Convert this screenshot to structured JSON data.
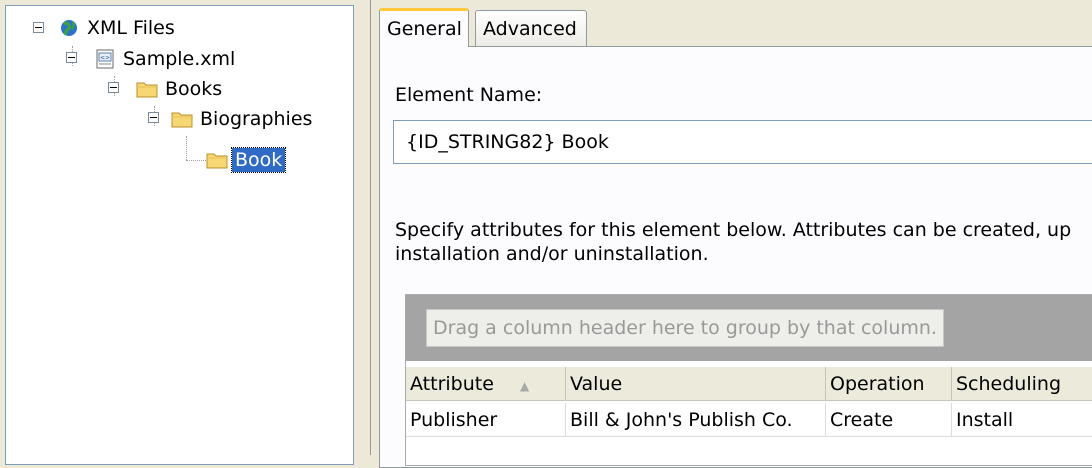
{
  "tree": {
    "root": "XML Files",
    "file": "Sample.xml",
    "books": "Books",
    "biographies": "Biographies",
    "book": "Book"
  },
  "tabs": [
    {
      "label": "General",
      "active": true
    },
    {
      "label": "Advanced",
      "active": false
    }
  ],
  "general": {
    "element_name_label": "Element Name:",
    "element_name_value": "{ID_STRING82} Book",
    "description_line1": "Specify attributes for this element below. Attributes can be created, up",
    "description_line2": "installation and/or uninstallation."
  },
  "grid": {
    "group_hint": "Drag a column header here to group by that column.",
    "columns": [
      "Attribute",
      "Value",
      "Operation",
      "Scheduling"
    ],
    "rows": [
      [
        "Publisher",
        "Bill & John's Publish Co.",
        "Create",
        "Install"
      ]
    ]
  },
  "colors": {
    "selection": "#316ac5",
    "tab_highlight": "#ffc83c",
    "folder": "#f7d774",
    "window_bg": "#ece9d8"
  },
  "icons": [
    "globe-icon",
    "xml-file-icon",
    "folder-icon",
    "folder-open-icon",
    "sort-ascending-icon"
  ]
}
